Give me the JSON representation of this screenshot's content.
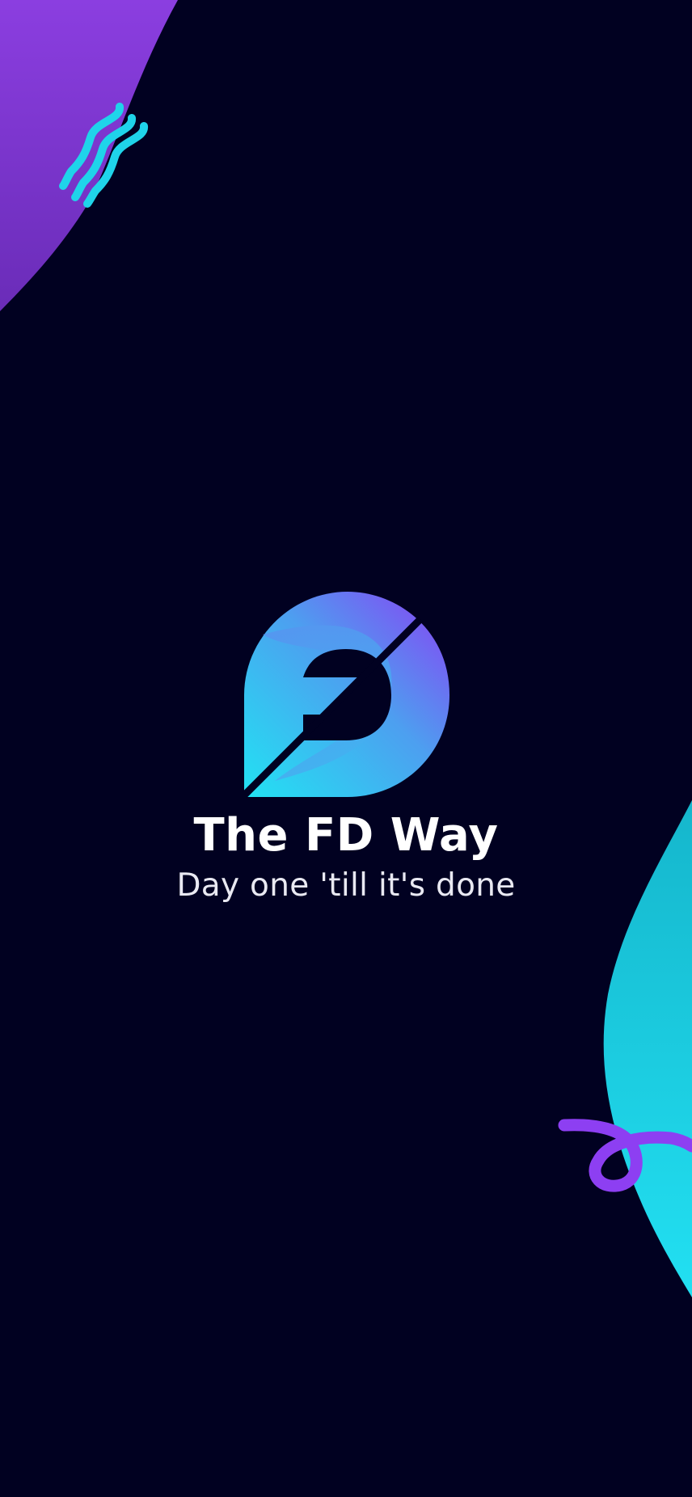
{
  "app": {
    "title": "The FD Way",
    "tagline": "Day one 'till it's done"
  },
  "colors": {
    "background": "#010121",
    "purple": "#8a3ff0",
    "cyan": "#1fd8ee",
    "text": "#ffffff"
  },
  "icons": {
    "logo": "fd-way-logo-icon",
    "squiggle": "wavy-lines-icon",
    "loop": "loop-squiggle-icon"
  }
}
